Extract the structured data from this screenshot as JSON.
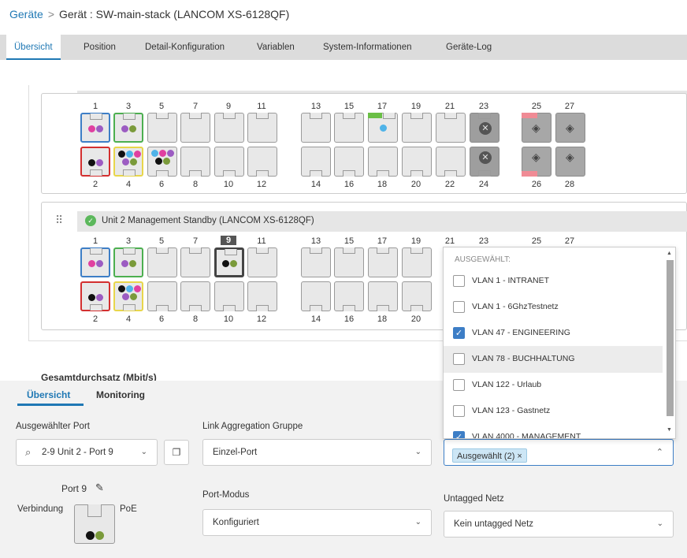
{
  "breadcrumb": {
    "root": "Geräte",
    "sep": ">",
    "current": "Gerät : SW-main-stack (LANCOM XS-6128QF)"
  },
  "tabs": [
    "Übersicht",
    "Position",
    "Detail-Konfiguration",
    "Variablen",
    "System-Informationen",
    "Geräte-Log"
  ],
  "unit1": {
    "top_numbers": [
      "1",
      "3",
      "5",
      "7",
      "9",
      "11",
      "13",
      "15",
      "17",
      "19",
      "21",
      "23",
      "25",
      "27"
    ],
    "bottom_numbers": [
      "2",
      "4",
      "6",
      "8",
      "10",
      "12",
      "14",
      "16",
      "18",
      "20",
      "22",
      "24",
      "26",
      "28"
    ]
  },
  "unit2": {
    "title": "Unit 2  Management Standby (LANCOM XS-6128QF)",
    "top_numbers": [
      "1",
      "3",
      "5",
      "7",
      "9",
      "11",
      "13",
      "15",
      "17",
      "19",
      "21",
      "23",
      "25",
      "27"
    ],
    "bottom_numbers": [
      "2",
      "4",
      "6",
      "8",
      "10",
      "12",
      "14",
      "16",
      "18",
      "20"
    ],
    "selected_port": "9"
  },
  "colors": {
    "blue": "#3d7ec6",
    "green": "#4caf50",
    "red": "#d32f2f",
    "yellow": "#e8d64a",
    "pink": "#e040a0",
    "purple": "#9c5cc2",
    "olive": "#7a9a3a",
    "black": "#111111",
    "cyan": "#4fb3e8",
    "accent": "#1f78b4"
  },
  "section_title": "Gesamtdurchsatz (Mbit/s)",
  "bottom_tabs": {
    "overview": "Übersicht",
    "monitoring": "Monitoring"
  },
  "fields": {
    "selected_port_label": "Ausgewählter Port",
    "selected_port_value": "2-9 Unit 2 - Port 9",
    "lag_label": "Link Aggregation Gruppe",
    "lag_value": "Einzel-Port",
    "vlan_tag": "Ausgewählt (2) ×",
    "port_mode_label": "Port-Modus",
    "port_mode_value": "Konfiguriert",
    "untagged_label": "Untagged Netz",
    "untagged_value": "Kein untagged Netz"
  },
  "port_card": {
    "title": "Port 9",
    "left_label": "Verbindung",
    "right_label": "PoE"
  },
  "dropdown": {
    "header": "AUSGEWÄHLT:",
    "options": [
      {
        "label": "VLAN 1 - INTRANET",
        "checked": false
      },
      {
        "label": "VLAN 1 - 6GhzTestnetz",
        "checked": false
      },
      {
        "label": "VLAN 47 - ENGINEERING",
        "checked": true
      },
      {
        "label": "VLAN 78 - BUCHHALTUNG",
        "checked": false
      },
      {
        "label": "VLAN 122 - Urlaub",
        "checked": false
      },
      {
        "label": "VLAN 123 - Gastnetz",
        "checked": false
      },
      {
        "label": "VLAN 4000 - MANAGEMENT",
        "checked": true
      }
    ]
  }
}
